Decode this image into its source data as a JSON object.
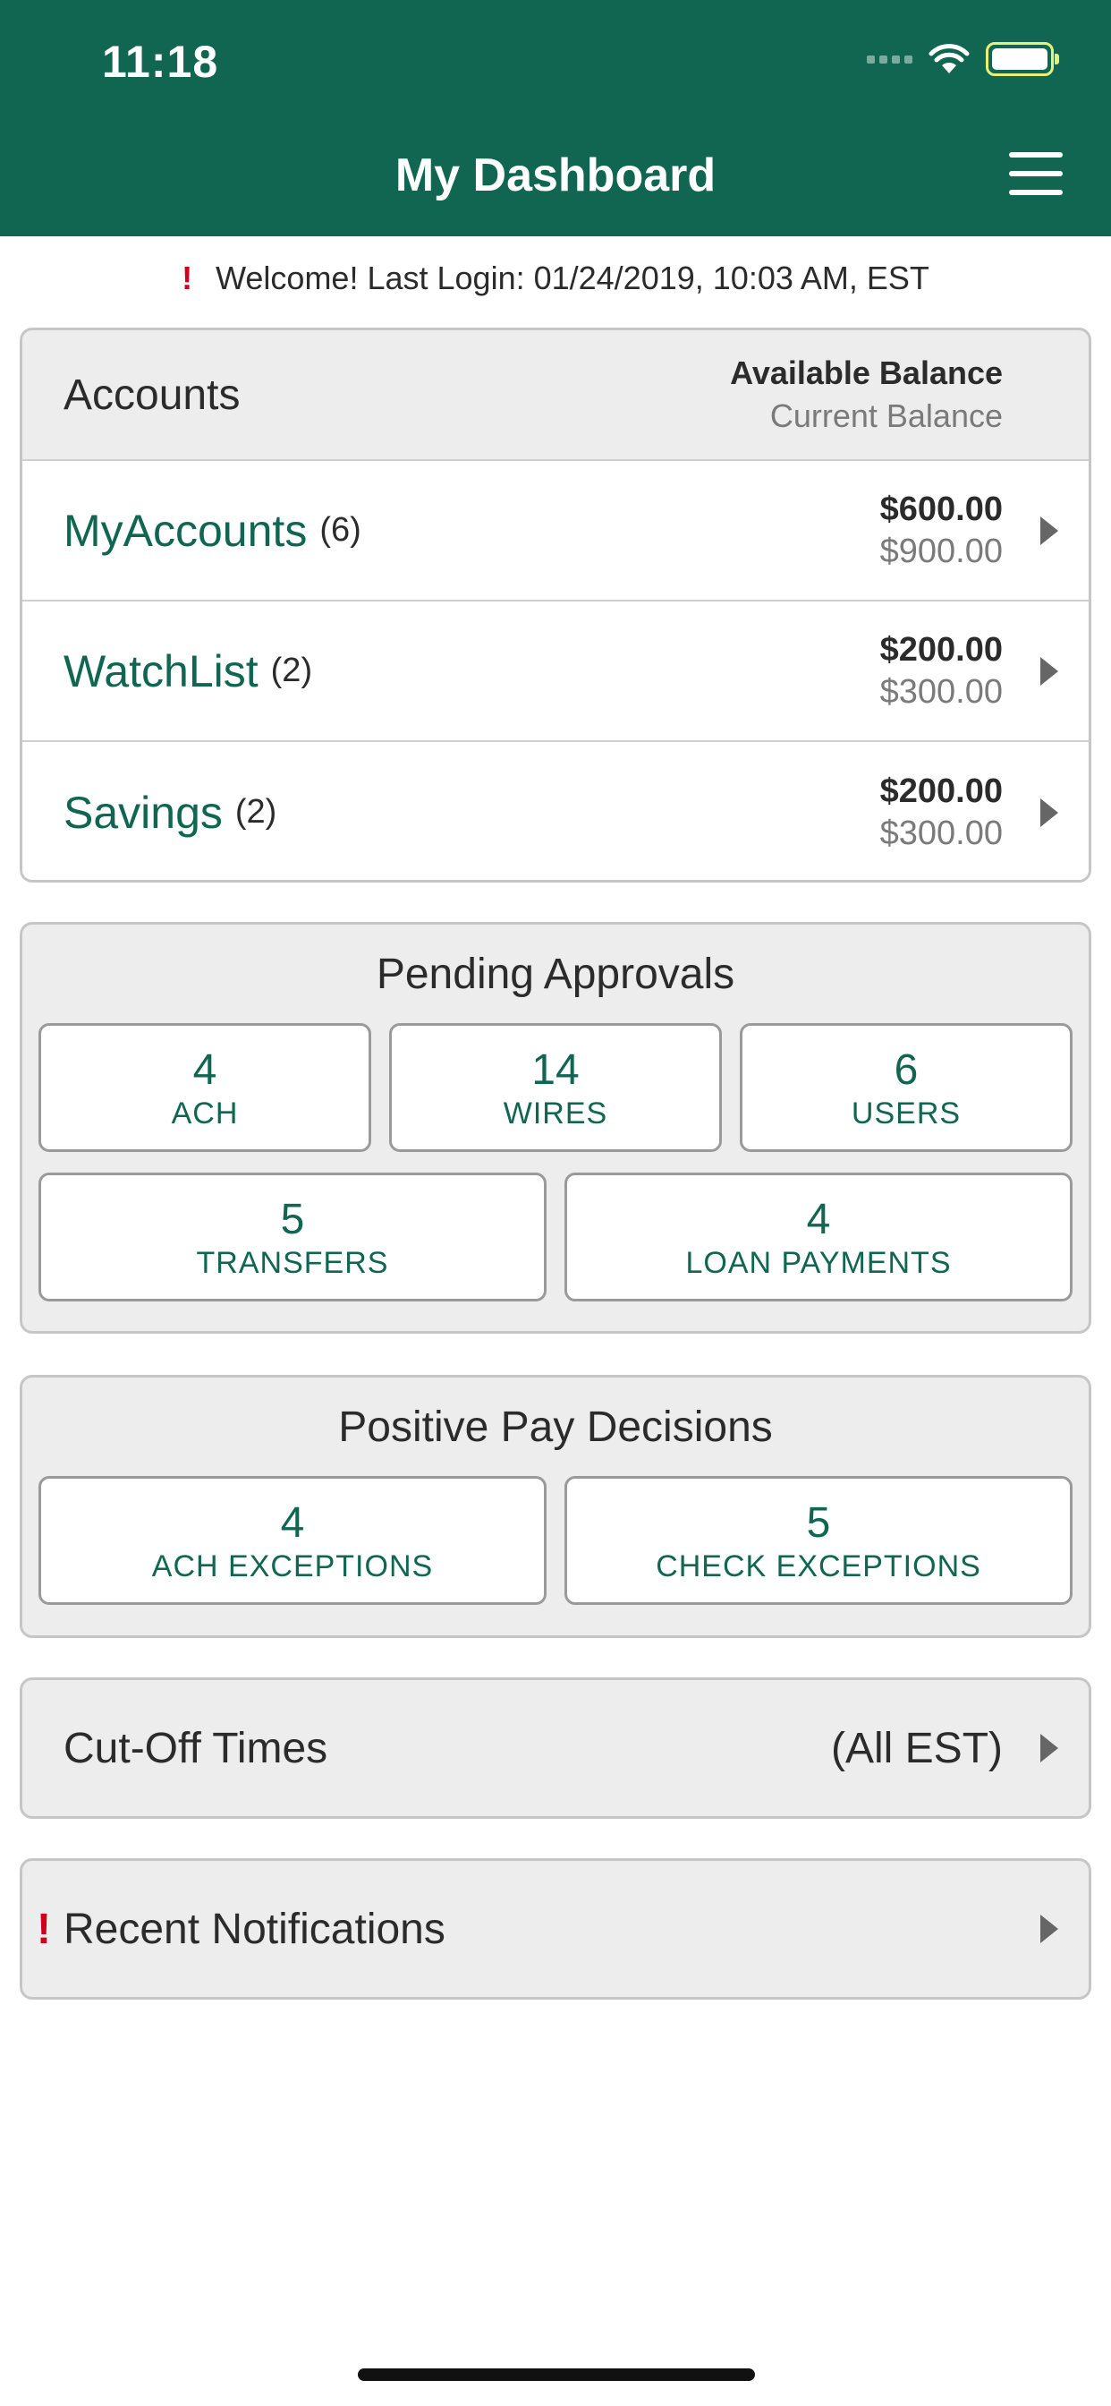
{
  "status_bar": {
    "time": "11:18"
  },
  "header": {
    "title": "My Dashboard",
    "menu_icon": "hamburger-menu-icon"
  },
  "welcome": {
    "alert_icon": "!",
    "text": "Welcome! Last Login: 01/24/2019, 10:03 AM, EST"
  },
  "accounts": {
    "title": "Accounts",
    "available_label": "Available Balance",
    "current_label": "Current Balance",
    "rows": [
      {
        "name": "MyAccounts",
        "count": "(6)",
        "available": "$600.00",
        "current": "$900.00"
      },
      {
        "name": "WatchList",
        "count": "(2)",
        "available": "$200.00",
        "current": "$300.00"
      },
      {
        "name": "Savings",
        "count": "(2)",
        "available": "$200.00",
        "current": "$300.00"
      }
    ]
  },
  "pending_approvals": {
    "title": "Pending Approvals",
    "tiles": [
      {
        "count": "4",
        "label": "ACH"
      },
      {
        "count": "14",
        "label": "WIRES"
      },
      {
        "count": "6",
        "label": "USERS"
      },
      {
        "count": "5",
        "label": "TRANSFERS"
      },
      {
        "count": "4",
        "label": "LOAN PAYMENTS"
      }
    ]
  },
  "positive_pay": {
    "title": "Positive Pay Decisions",
    "tiles": [
      {
        "count": "4",
        "label": "ACH EXCEPTIONS"
      },
      {
        "count": "5",
        "label": "CHECK EXCEPTIONS"
      }
    ]
  },
  "cutoff": {
    "label": "Cut-Off Times",
    "value": "(All EST)"
  },
  "notifications": {
    "alert_icon": "!",
    "label": "Recent Notifications"
  },
  "colors": {
    "brand_green": "#106650",
    "alert_red": "#d0021b"
  }
}
